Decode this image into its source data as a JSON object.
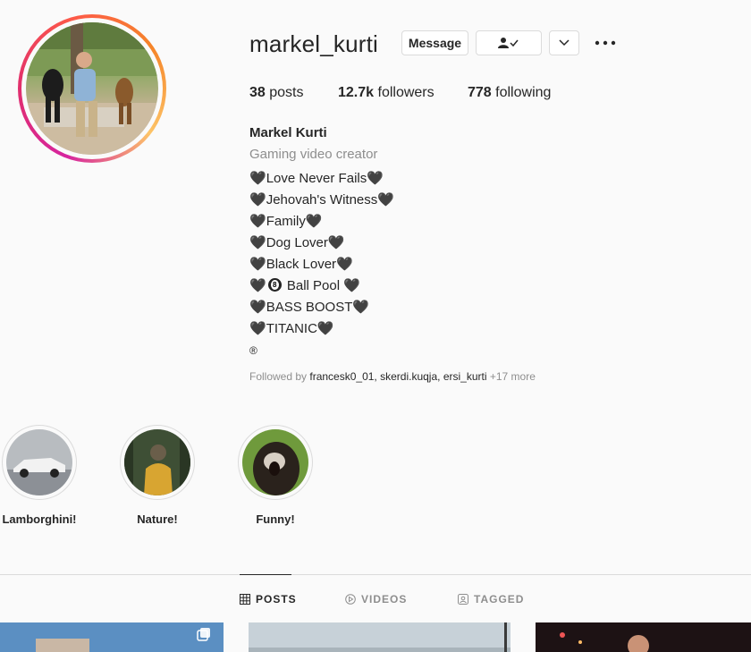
{
  "profile": {
    "username": "markel_kurti",
    "message_label": "Message",
    "stats": {
      "posts_count": "38",
      "posts_label": "posts",
      "followers_count": "12.7k",
      "followers_label": "followers",
      "following_count": "778",
      "following_label": "following"
    },
    "full_name": "Markel Kurti",
    "category": "Gaming video creator",
    "bio": [
      {
        "pre": "",
        "text": "Love Never Fails"
      },
      {
        "pre": "",
        "text": "Jehovah's Witness"
      },
      {
        "pre": "",
        "text": "Family"
      },
      {
        "pre": "",
        "text": "Dog Lover"
      },
      {
        "pre": "",
        "text": "Black Lover"
      },
      {
        "pre": "",
        "text": "Ball Pool"
      },
      {
        "pre": "",
        "text": "BASS BOOST"
      },
      {
        "pre": "",
        "text": "TITANIC"
      }
    ],
    "registered_mark": "®",
    "followed_by": {
      "prefix": "Followed by",
      "users": [
        "francesk0_01",
        "skerdi.kuqja",
        "ersi_kurti"
      ],
      "more": "+17 more"
    }
  },
  "highlights": [
    {
      "label": "Lamborghini!"
    },
    {
      "label": "Nature!"
    },
    {
      "label": "Funny!"
    }
  ],
  "tabs": [
    {
      "label": "POSTS",
      "icon": "grid-icon",
      "active": true
    },
    {
      "label": "VIDEOS",
      "icon": "play-icon",
      "active": false
    },
    {
      "label": "TAGGED",
      "icon": "tag-icon",
      "active": false
    }
  ],
  "colors": {
    "background": "#fafafa",
    "text": "#262626",
    "muted": "#8e8e8e",
    "border": "#dbdbdb"
  }
}
